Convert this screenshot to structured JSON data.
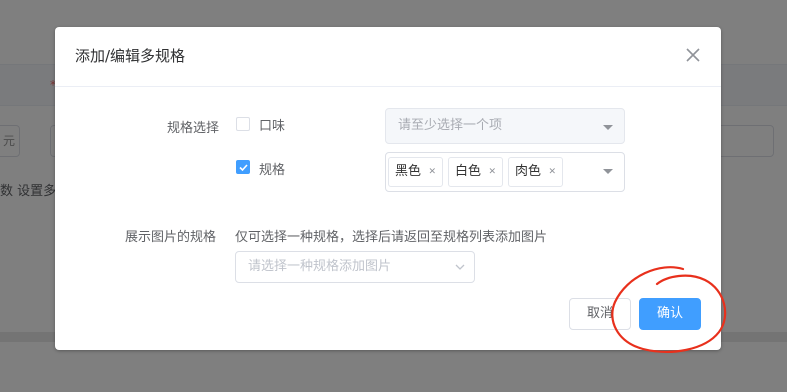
{
  "background": {
    "left_cell_text": "元",
    "hint_text": "数 设置多"
  },
  "dialog": {
    "title": "添加/编辑多规格",
    "spec_select_label": "规格选择",
    "options": [
      {
        "label": "口味",
        "checked": false,
        "placeholder": "请至少选择一个项"
      },
      {
        "label": "规格",
        "checked": true,
        "tags": [
          "黑色",
          "白色",
          "肉色"
        ]
      }
    ],
    "image_spec_label": "展示图片的规格",
    "image_spec_hint": "仅可选择一种规格，选择后请返回至规格列表添加图片",
    "image_spec_placeholder": "请选择一种规格添加图片",
    "cancel_label": "取消",
    "confirm_label": "确认"
  },
  "colors": {
    "primary": "#409eff",
    "annotation": "#e8301c"
  }
}
